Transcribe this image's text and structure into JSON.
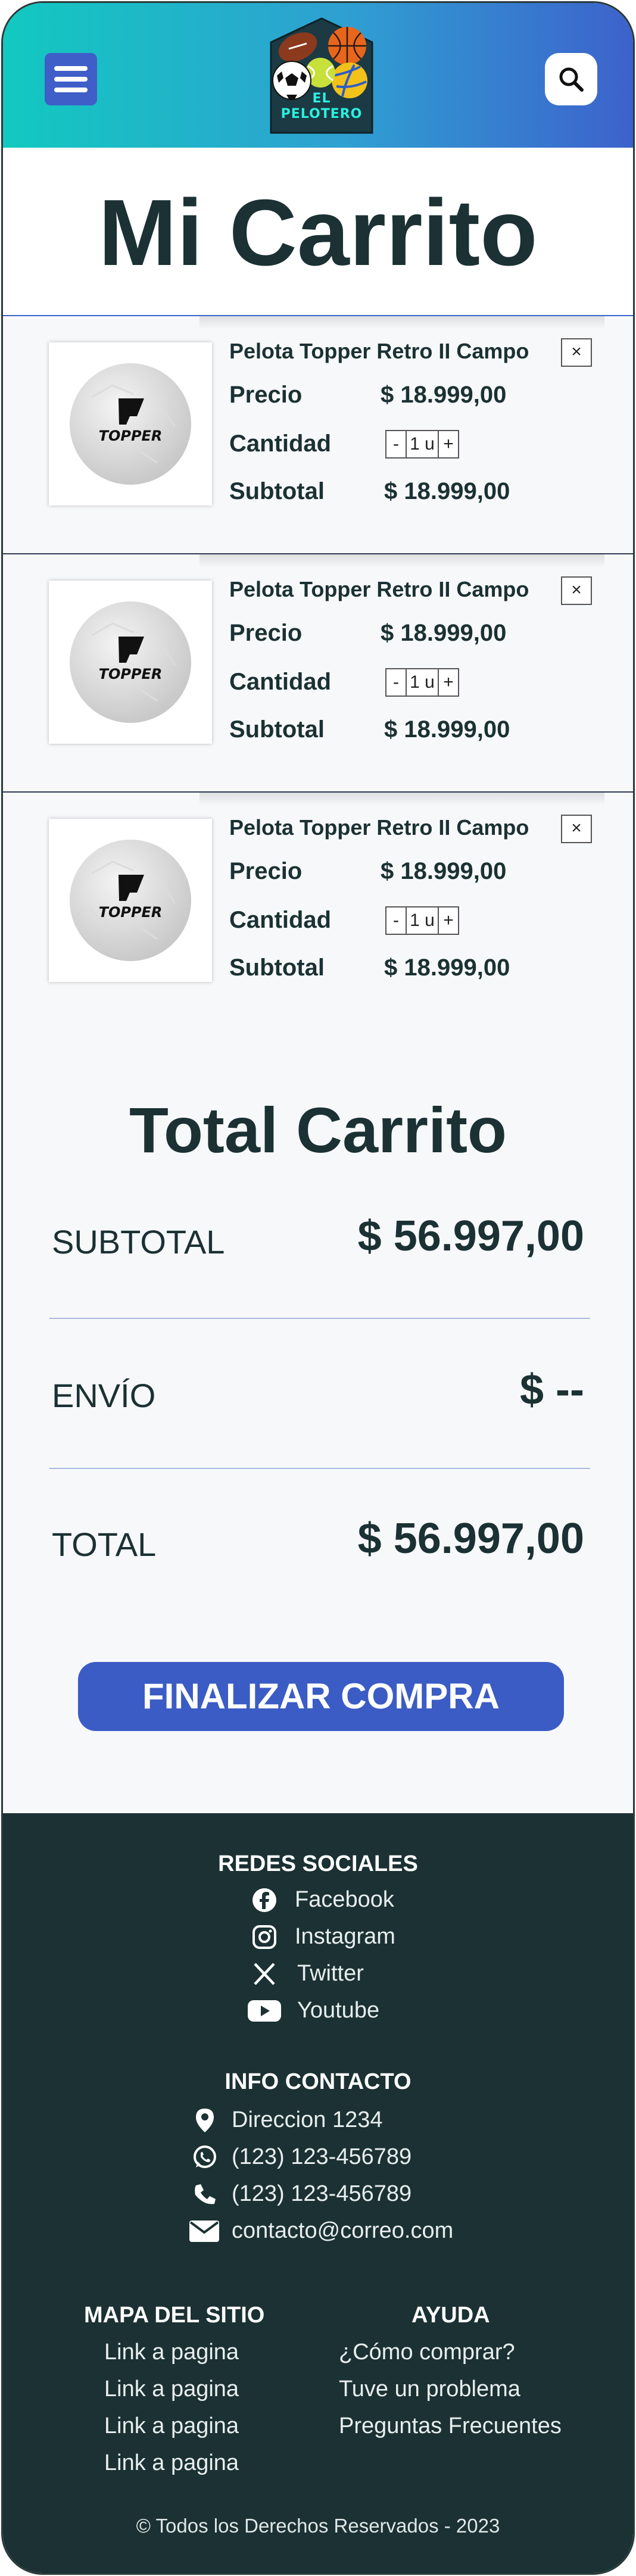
{
  "header": {
    "logo_line1": "EL",
    "logo_line2": "PELOTERO"
  },
  "page_title": "Mi Carrito",
  "cart": {
    "remove_label": "×",
    "price_label": "Precio",
    "quantity_label": "Cantidad",
    "subtotal_label": "Subtotal",
    "minus_label": "-",
    "plus_label": "+",
    "items": [
      {
        "name": "Pelota Topper Retro II Campo",
        "price": "$ 18.999,00",
        "quantity": "1 u",
        "subtotal": "$ 18.999,00",
        "brand": "TOPPER"
      },
      {
        "name": "Pelota Topper Retro II Campo",
        "price": "$ 18.999,00",
        "quantity": "1 u",
        "subtotal": "$ 18.999,00",
        "brand": "TOPPER"
      },
      {
        "name": "Pelota Topper Retro II Campo",
        "price": "$ 18.999,00",
        "quantity": "1 u",
        "subtotal": "$ 18.999,00",
        "brand": "TOPPER"
      }
    ]
  },
  "totals": {
    "title": "Total Carrito",
    "subtotal_label": "SUBTOTAL",
    "subtotal_value": "$ 56.997,00",
    "shipping_label": "ENVÍO",
    "shipping_value": "$ --",
    "total_label": "TOTAL",
    "total_value": "$ 56.997,00",
    "checkout_label": "FINALIZAR COMPRA"
  },
  "footer": {
    "social_heading": "REDES SOCIALES",
    "social": [
      {
        "icon": "facebook-icon",
        "label": "Facebook"
      },
      {
        "icon": "instagram-icon",
        "label": "Instagram"
      },
      {
        "icon": "x-twitter-icon",
        "label": "Twitter"
      },
      {
        "icon": "youtube-icon",
        "label": "Youtube"
      }
    ],
    "contact_heading": "INFO CONTACTO",
    "contact": [
      {
        "icon": "location-pin-icon",
        "label": "Direccion 1234"
      },
      {
        "icon": "whatsapp-icon",
        "label": "(123) 123-456789"
      },
      {
        "icon": "phone-icon",
        "label": "(123) 123-456789"
      },
      {
        "icon": "envelope-icon",
        "label": "contacto@correo.com"
      }
    ],
    "sitemap_heading": "MAPA DEL SITIO",
    "sitemap_links": [
      "Link a pagina",
      "Link a pagina",
      "Link a pagina",
      "Link a pagina"
    ],
    "help_heading": "AYUDA",
    "help_links": [
      "¿Cómo comprar?",
      "Tuve un problema",
      "Preguntas Frecuentes"
    ],
    "copyright": "© Todos los Derechos Reservados - 2023"
  },
  "colors": {
    "header_gradient_start": "#12c9c0",
    "header_gradient_end": "#3d62cc",
    "accent_blue": "#3b5cc4",
    "dark_teal": "#1b3133"
  }
}
